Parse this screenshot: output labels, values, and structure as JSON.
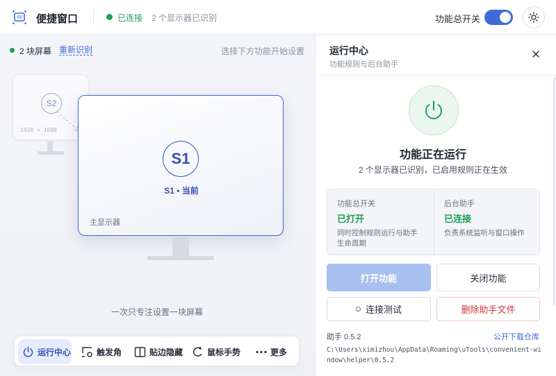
{
  "header": {
    "app_title": "便捷窗口",
    "connection_status": "已连接",
    "monitor_count_text": "2 个显示器已识别",
    "master_switch_label": "功能总开关",
    "master_switch_on": true,
    "accent_color": "#3f6ad8",
    "status_color": "#1e9e5a"
  },
  "layout_panel": {
    "screens_text": "2 块屏幕",
    "reidentify_label": "重新识别",
    "hint_right": "选择下方功能开始设置",
    "monitors": [
      {
        "id": "S2",
        "resolution": "1920 × 1080"
      },
      {
        "id": "S1",
        "caption": "S1 • 当前",
        "role": "主显示器"
      }
    ],
    "focus_hint": "一次只专注设置一块屏幕"
  },
  "dock": {
    "items": [
      {
        "label": "运行中心",
        "icon": "power-icon",
        "active": true
      },
      {
        "label": "触发角",
        "icon": "corner-icon",
        "active": false
      },
      {
        "label": "贴边隐藏",
        "icon": "split-panel-icon",
        "active": false
      },
      {
        "label": "鼠标手势",
        "icon": "gesture-icon",
        "active": false
      },
      {
        "label": "更多",
        "icon": "more-dots-icon",
        "active": false
      }
    ]
  },
  "run_panel": {
    "title": "运行中心",
    "subtitle": "功能规则与后台助手",
    "status_title": "功能正在运行",
    "status_subtitle": "2 个显示器已识别，已启用规则正在生效",
    "cards": [
      {
        "label": "功能总开关",
        "value": "已打开",
        "desc": "同时控制规则运行与助手生命周期"
      },
      {
        "label": "后台助手",
        "value": "已连接",
        "desc": "负责系统监听与窗口操作"
      }
    ],
    "buttons": {
      "open": "打开功能",
      "close": "关闭功能",
      "test": "连接测试",
      "delete": "删除助手文件"
    },
    "helper_version": "助手 0.5.2",
    "download_link": "公开下载仓库",
    "helper_path": "C:\\Users\\ximizhou\\AppData\\Roaming\\uTools\\convenient-window\\helper\\0.5.2"
  }
}
